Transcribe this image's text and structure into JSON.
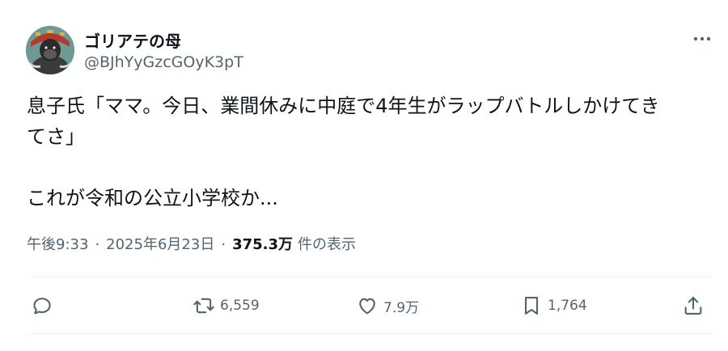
{
  "author": {
    "display_name": "ゴリアテの母",
    "handle": "@BJhYyGzcGOyK3pT"
  },
  "tweet": {
    "lines": [
      "息子氏「ママ。今日、業間休みに中庭で4年生がラップバトルしかけてき",
      "てさ」",
      "これが令和の公立小学校か..."
    ],
    "time": "午後9:33",
    "date": "2025年6月23日",
    "separator": "·",
    "views_count": "375.3万",
    "views_label": "件の表示"
  },
  "actions": {
    "reply": {
      "icon": "reply-icon",
      "count": ""
    },
    "retweet": {
      "icon": "retweet-icon",
      "count": "6,559"
    },
    "like": {
      "icon": "heart-icon",
      "count": "7.9万"
    },
    "bookmark": {
      "icon": "bookmark-icon",
      "count": "1,764"
    },
    "share": {
      "icon": "share-icon",
      "count": ""
    }
  },
  "colors": {
    "text_primary": "#0f1419",
    "text_secondary": "#536471",
    "divider": "#eff3f4"
  }
}
